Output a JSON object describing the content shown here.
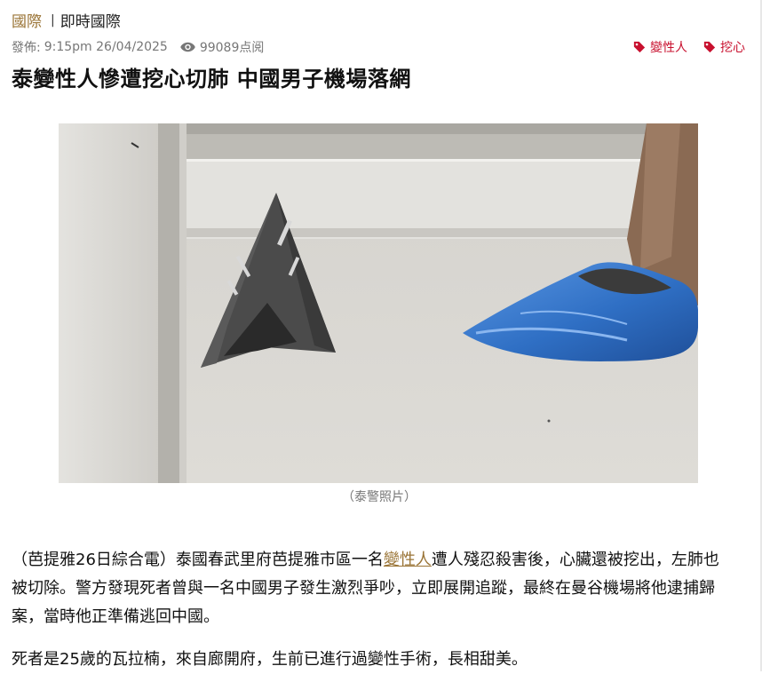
{
  "breadcrumb": {
    "category": "國際",
    "separator": "|",
    "subcategory": "即時國際"
  },
  "meta": {
    "published_label": "發佈:",
    "published": "9:15pm 26/04/2025",
    "views": "99089点阅"
  },
  "tags": [
    {
      "label": "變性人"
    },
    {
      "label": "挖心"
    }
  ],
  "article": {
    "title": "泰變性人慘遭挖心切肺 中國男子機場落網",
    "image_caption": "（泰警照片）",
    "p1_pre": "（芭提雅26日綜合電）泰國春武里府芭提雅市區一名",
    "p1_link": "變性人",
    "p1_post": "遭人殘忍殺害後，心臟還被挖出，左肺也被切除。警方發現死者曾與一名中國男子發生激烈爭吵，立即展開追蹤，最終在曼谷機場將他逮捕歸案，當時他正準備逃回中國。",
    "p2": "死者是25歲的瓦拉楠，來自廊開府，生前已進行過變性手術，長相甜美。"
  },
  "colors": {
    "category": "#9a7436",
    "tag": "#c8102e",
    "meta": "#777777",
    "shoe_cover": "#2f6fc4"
  }
}
